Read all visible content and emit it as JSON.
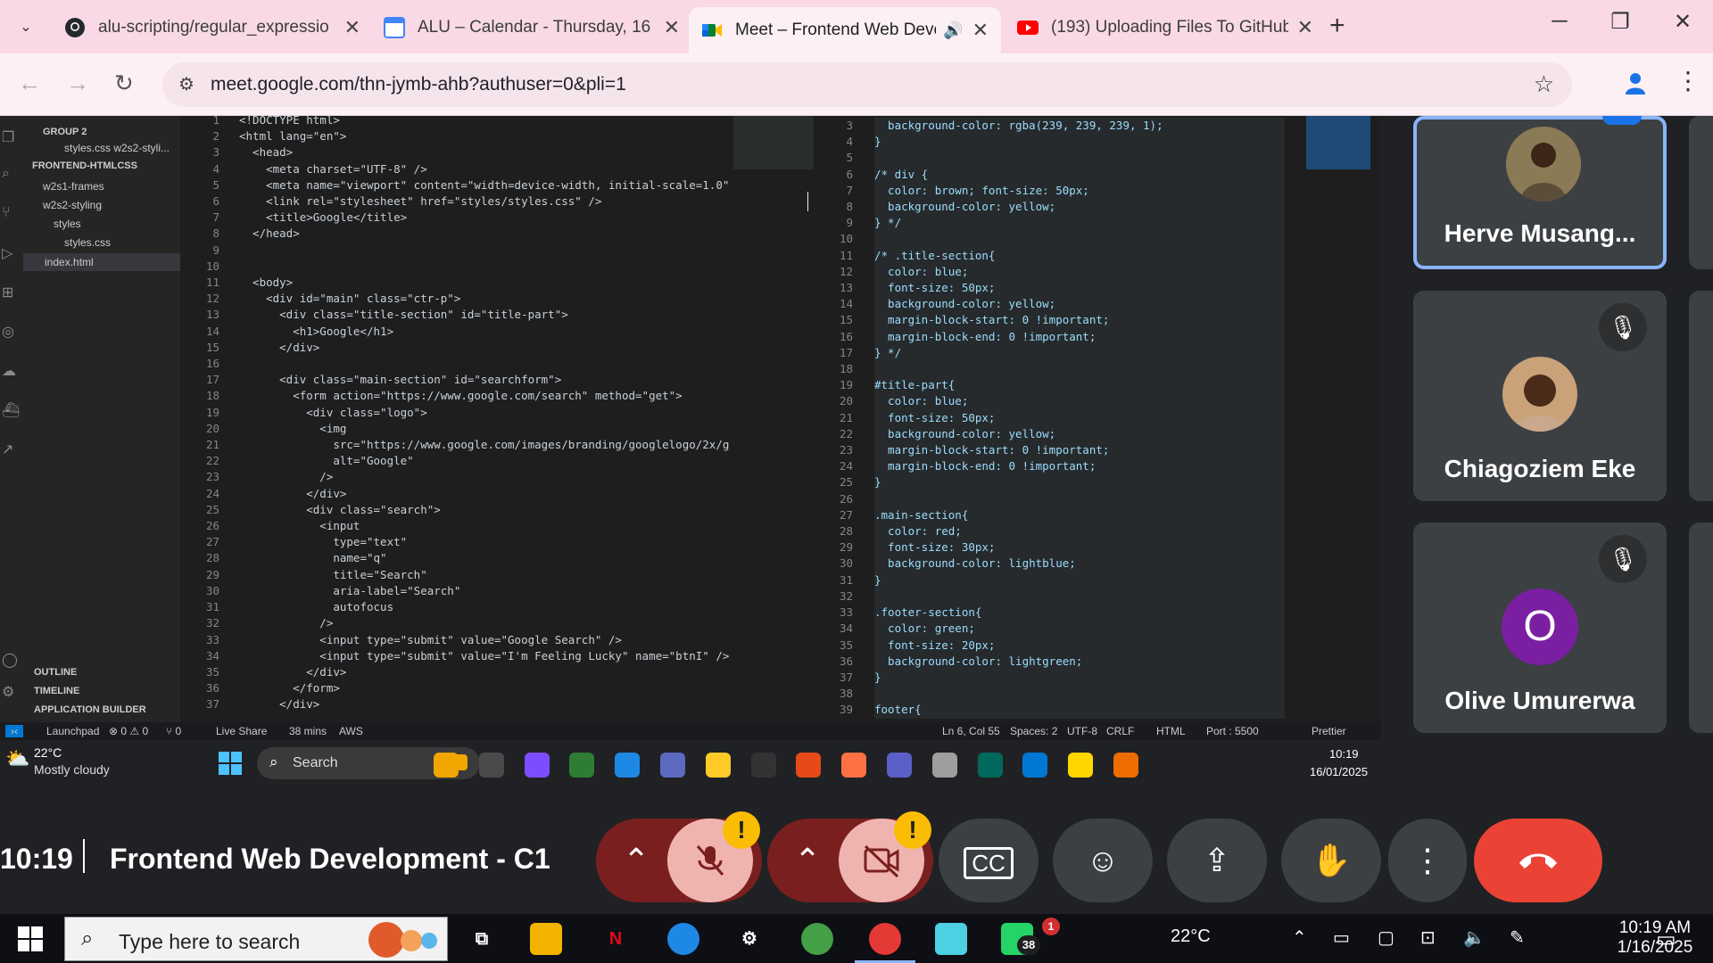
{
  "browser": {
    "tab_list_glyph": "⌄",
    "tabs": [
      {
        "title": "alu-scripting/regular_expressio",
        "close": "✕"
      },
      {
        "title": "ALU – Calendar - Thursday, 16 J",
        "close": "✕",
        "favicon_text": "16"
      },
      {
        "title": "Meet – Frontend Web Deve",
        "close": "✕",
        "active": true
      },
      {
        "title": "(193) Uploading Files To GitHub",
        "close": "✕"
      }
    ],
    "new_tab": "+",
    "window": {
      "minimize": "─",
      "restore": "❐",
      "close": "✕"
    },
    "nav": {
      "back": "←",
      "forward": "→",
      "reload": "↻"
    },
    "url": "meet.google.com/thn-jymb-ahb?authuser=0&pli=1",
    "star": "☆",
    "menu": "⋮"
  },
  "vscode": {
    "explorer": {
      "group": "GROUP 2",
      "items": [
        {
          "label": "styles.css  w2s2-styli...",
          "indent": 2
        },
        {
          "label": "FRONTEND-HTMLCSS",
          "indent": 0,
          "bold": true
        },
        {
          "label": "w2s1-frames",
          "indent": 1
        },
        {
          "label": "w2s2-styling",
          "indent": 1
        },
        {
          "label": "styles",
          "indent": 2
        },
        {
          "label": "styles.css",
          "indent": 3
        },
        {
          "label": "index.html",
          "indent": 2,
          "selected": true
        }
      ],
      "outline": "OUTLINE",
      "timeline": "TIMELINE",
      "app_builder": "APPLICATION BUILDER"
    },
    "left_lines": [
      "<!DOCTYPE html>",
      "<html lang=\"en\">",
      "  <head>",
      "    <meta charset=\"UTF-8\" />",
      "    <meta name=\"viewport\" content=\"width=device-width, initial-scale=1.0\"",
      "    <link rel=\"stylesheet\" href=\"styles/styles.css\" />",
      "    <title>Google</title>",
      "  </head>",
      "",
      "",
      "  <body>",
      "    <div id=\"main\" class=\"ctr-p\">",
      "      <div class=\"title-section\" id=\"title-part\">",
      "        <h1>Google</h1>",
      "      </div>",
      "",
      "      <div class=\"main-section\" id=\"searchform\">",
      "        <form action=\"https://www.google.com/search\" method=\"get\">",
      "          <div class=\"logo\">",
      "            <img",
      "              src=\"https://www.google.com/images/branding/googlelogo/2x/g",
      "              alt=\"Google\"",
      "            />",
      "          </div>",
      "          <div class=\"search\">",
      "            <input",
      "              type=\"text\"",
      "              name=\"q\"",
      "              title=\"Search\"",
      "              aria-label=\"Search\"",
      "              autofocus",
      "            />",
      "            <input type=\"submit\" value=\"Google Search\" />",
      "            <input type=\"submit\" value=\"I'm Feeling Lucky\" name=\"btnI\" />",
      "          </div>",
      "        </form>",
      "      </div>"
    ],
    "left_start": 1,
    "right_lines": [
      "  background-color: rgba(239, 239, 239, 1);",
      "}",
      "",
      "/* div {",
      "  color: brown; font-size: 50px;",
      "  background-color: yellow;",
      "} */",
      "",
      "/* .title-section{",
      "  color: blue;",
      "  font-size: 50px;",
      "  background-color: yellow;",
      "  margin-block-start: 0 !important;",
      "  margin-block-end: 0 !important;",
      "} */",
      "",
      "#title-part{",
      "  color: blue;",
      "  font-size: 50px;",
      "  background-color: yellow;",
      "  margin-block-start: 0 !important;",
      "  margin-block-end: 0 !important;",
      "}",
      "",
      ".main-section{",
      "  color: red;",
      "  font-size: 30px;",
      "  background-color: lightblue;",
      "}",
      "",
      ".footer-section{",
      "  color: green;",
      "  font-size: 20px;",
      "  background-color: lightgreen;",
      "}",
      "",
      "footer{"
    ],
    "right_start": 3,
    "status": {
      "launchpad": "Launchpad",
      "problems": "⊗ 0 ⚠ 0",
      "ports": "⑂ 0",
      "live_share": "Live Share",
      "timer": "38 mins",
      "aws": "AWS",
      "position": "Ln 6, Col 55",
      "spaces": "Spaces: 2",
      "encoding": "UTF-8",
      "eol": "CRLF",
      "language": "HTML",
      "port": "Port : 5500",
      "prettier": "Prettier"
    }
  },
  "inner_taskbar": {
    "weather_temp": "22°C",
    "weather_desc": "Mostly cloudy",
    "search": "Search",
    "time": "10:19",
    "date": "16/01/2025"
  },
  "participants": [
    {
      "name": "Herve Musang...",
      "speaking": true
    },
    {
      "name": "Chiagoziem Eke",
      "muted": true
    },
    {
      "name": "Olive Umurerwa",
      "muted": true,
      "initial": "O"
    }
  ],
  "meeting": {
    "clock": "10:19",
    "title": "Frontend Web Development - C1",
    "warning": "!"
  },
  "taskbar": {
    "search_placeholder": "Type here to search",
    "whatsapp_badge": "38",
    "weather_badge": "1",
    "temp": "22°C",
    "time": "10:19 AM",
    "date": "1/16/2025"
  },
  "colors": {
    "meet_bg": "#202124",
    "tile_bg": "#3c4043",
    "speaking_border": "#8ab4f8",
    "end_call": "#ea4335",
    "warning": "#fbbc04",
    "chrome_tabbar": "#f9d9e6"
  }
}
